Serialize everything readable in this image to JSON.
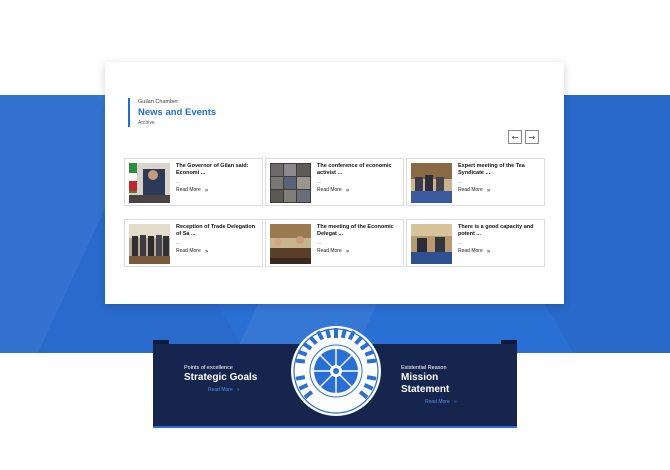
{
  "news": {
    "kicker": "Guilan Chamber",
    "title": "News and Events",
    "subtitle": "Archive",
    "prev_icon": "arrow-left-icon",
    "next_icon": "arrow-right-icon",
    "read_more": "Read More",
    "items": [
      {
        "title": "The Governor of Gilan said: Economi ...",
        "dots": "...",
        "read_more": "Read More"
      },
      {
        "title": "The conference of economic activist ...",
        "dots": "...",
        "read_more": "Read More"
      },
      {
        "title": "Expert meeting of the Tea Syndicate ...",
        "dots": "...",
        "read_more": "Read More"
      },
      {
        "title": "Reception of Trade Delegation of Sa ...",
        "dots": "...",
        "read_more": "Read More"
      },
      {
        "title": "The meeting of the Economic Delegat ...",
        "dots": "...",
        "read_more": "Read More"
      },
      {
        "title": "There is a good capacity and potent ...",
        "dots": "...",
        "read_more": "Read More"
      }
    ]
  },
  "goals": {
    "left": {
      "kicker": "Points of excellence",
      "title": "Strategic Goals",
      "link": "Read More"
    },
    "right": {
      "kicker": "Existential Reason",
      "title_line1": "Mission",
      "title_line2": "Statement",
      "link": "Read More"
    }
  },
  "colors": {
    "accent": "#1f6fd0",
    "band": "#2a6fd4",
    "navy": "#16254d"
  }
}
